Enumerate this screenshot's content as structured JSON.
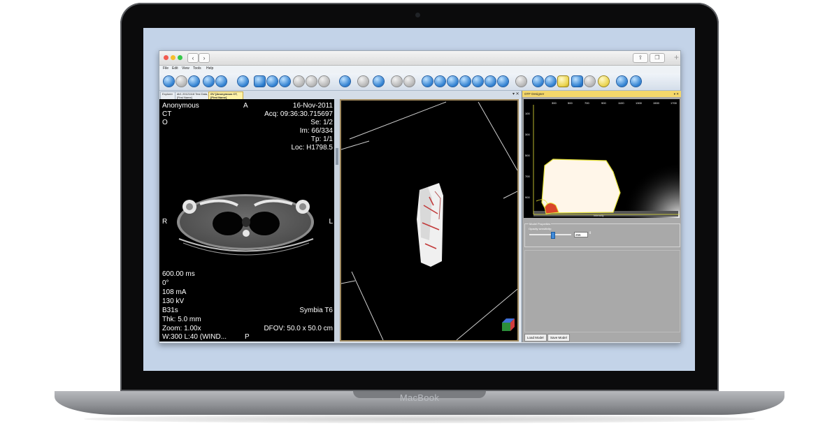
{
  "device": {
    "brand": "MacBook"
  },
  "window": {
    "menu": [
      "File",
      "Edit",
      "View",
      "Tools",
      "Help"
    ],
    "tabs": [
      {
        "label": "Explorer"
      },
      {
        "label": "dtr1 20121118 Test Data, [First Name]"
      },
      {
        "label": "GV [Anonymous CT, [First Name]"
      }
    ]
  },
  "left_viewport": {
    "tl": [
      "Anonymous",
      "CT",
      "O"
    ],
    "top_marker": "A",
    "tr": [
      "16-Nov-2011",
      "Acq: 09:36:30.715697",
      "Se: 1/2",
      "Im: 66/334",
      "Tp: 1/1",
      "Loc: H1798.5"
    ],
    "left_marker": "R",
    "right_marker": "L",
    "bl": [
      "600.00 ms",
      "0°",
      "108 mA",
      "130 kV",
      "B31s",
      "Thk: 5.0 mm",
      "Zoom: 1.00x",
      "W:300 L:40 (WIND..."
    ],
    "bottom_marker": "P",
    "br": [
      "Symbia T6",
      "",
      "DFOV: 50.0 x 50.0 cm"
    ]
  },
  "right_panel": {
    "header": "OTF Designer",
    "x_ticks": [
      "300",
      "500",
      "700",
      "900",
      "1100",
      "1300",
      "1500",
      "1700"
    ],
    "y_ticks": [
      "100",
      "300",
      "500",
      "700",
      "900"
    ],
    "x_label": "intensity",
    "model_properties": "Model Properties",
    "opacity_label": "Opacity sensitivity:",
    "opacity_value": "256",
    "opacity_fraction": 0.55,
    "load_button": "Load Model",
    "save_button": "Save Model"
  },
  "colors": {
    "screen_bg": "#c3d3e8",
    "toolbar_icon": "#2e7fd0",
    "active_tab": "#fff3a8",
    "otf_outline": "#e6e23a"
  }
}
